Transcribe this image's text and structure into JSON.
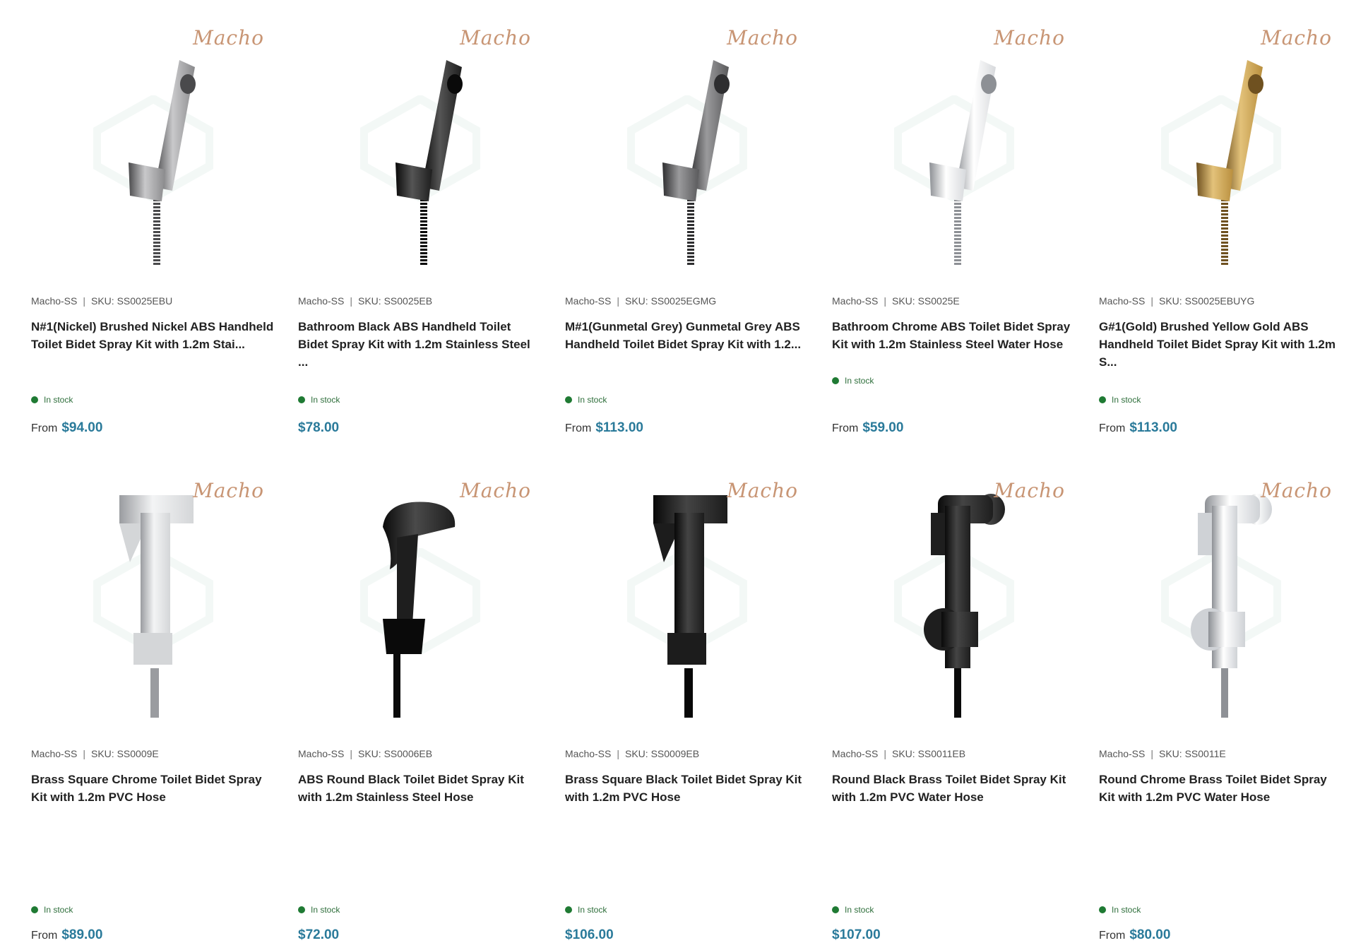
{
  "products": [
    {
      "brand": "Macho-SS",
      "sku_label": "SKU:",
      "sku": "SS0025EBU",
      "title": "N#1(Nickel) Brushed Nickel ABS Handheld Toilet Bidet Spray Kit with 1.2m Stai...",
      "stock": "In stock",
      "from": "From",
      "price": "$94.00",
      "finish": "nickel",
      "logo": "Macho"
    },
    {
      "brand": "Macho-SS",
      "sku_label": "SKU:",
      "sku": "SS0025EB",
      "title": "Bathroom Black ABS Handheld Toilet Bidet Spray Kit with 1.2m Stainless Steel ...",
      "stock": "In stock",
      "from": "",
      "price": "$78.00",
      "finish": "black",
      "logo": "Macho"
    },
    {
      "brand": "Macho-SS",
      "sku_label": "SKU:",
      "sku": "SS0025EGMG",
      "title": "M#1(Gunmetal Grey) Gunmetal Grey ABS Handheld Toilet Bidet Spray Kit with 1.2...",
      "stock": "In stock",
      "from": "From",
      "price": "$113.00",
      "finish": "gunmetal",
      "logo": "Macho"
    },
    {
      "brand": "Macho-SS",
      "sku_label": "SKU:",
      "sku": "SS0025E",
      "title": "Bathroom Chrome ABS Toilet Bidet Spray Kit with 1.2m Stainless Steel Water Hose",
      "stock": "In stock",
      "from": "From",
      "price": "$59.00",
      "finish": "chrome",
      "logo": "Macho"
    },
    {
      "brand": "Macho-SS",
      "sku_label": "SKU:",
      "sku": "SS0025EBUYG",
      "title": "G#1(Gold) Brushed Yellow Gold ABS Handheld Toilet Bidet Spray Kit with 1.2m S...",
      "stock": "In stock",
      "from": "From",
      "price": "$113.00",
      "finish": "gold",
      "logo": "Macho"
    },
    {
      "brand": "Macho-SS",
      "sku_label": "SKU:",
      "sku": "SS0009E",
      "title": "Brass Square Chrome Toilet Bidet Spray Kit with 1.2m PVC Hose",
      "stock": "In stock",
      "from": "From",
      "price": "$89.00",
      "finish": "chrome-square",
      "logo": "Macho"
    },
    {
      "brand": "Macho-SS",
      "sku_label": "SKU:",
      "sku": "SS0006EB",
      "title": "ABS Round Black Toilet Bidet Spray Kit with 1.2m Stainless Steel Hose",
      "stock": "In stock",
      "from": "",
      "price": "$72.00",
      "finish": "black-round",
      "logo": "Macho"
    },
    {
      "brand": "Macho-SS",
      "sku_label": "SKU:",
      "sku": "SS0009EB",
      "title": "Brass Square Black Toilet Bidet Spray Kit with 1.2m PVC Hose",
      "stock": "In stock",
      "from": "",
      "price": "$106.00",
      "finish": "black-square",
      "logo": "Macho"
    },
    {
      "brand": "Macho-SS",
      "sku_label": "SKU:",
      "sku": "SS0011EB",
      "title": "Round Black Brass Toilet Bidet Spray Kit with 1.2m PVC Water Hose",
      "stock": "In stock",
      "from": "",
      "price": "$107.00",
      "finish": "black-brass-round",
      "logo": "Macho"
    },
    {
      "brand": "Macho-SS",
      "sku_label": "SKU:",
      "sku": "SS0011E",
      "title": "Round Chrome Brass Toilet Bidet Spray Kit with 1.2m PVC Water Hose",
      "stock": "In stock",
      "from": "From",
      "price": "$80.00",
      "finish": "chrome-brass-round",
      "logo": "Macho"
    }
  ],
  "colors": {
    "price": "#2a7a9a",
    "stock_dot": "#1f7a33",
    "logo": "#c89574"
  }
}
